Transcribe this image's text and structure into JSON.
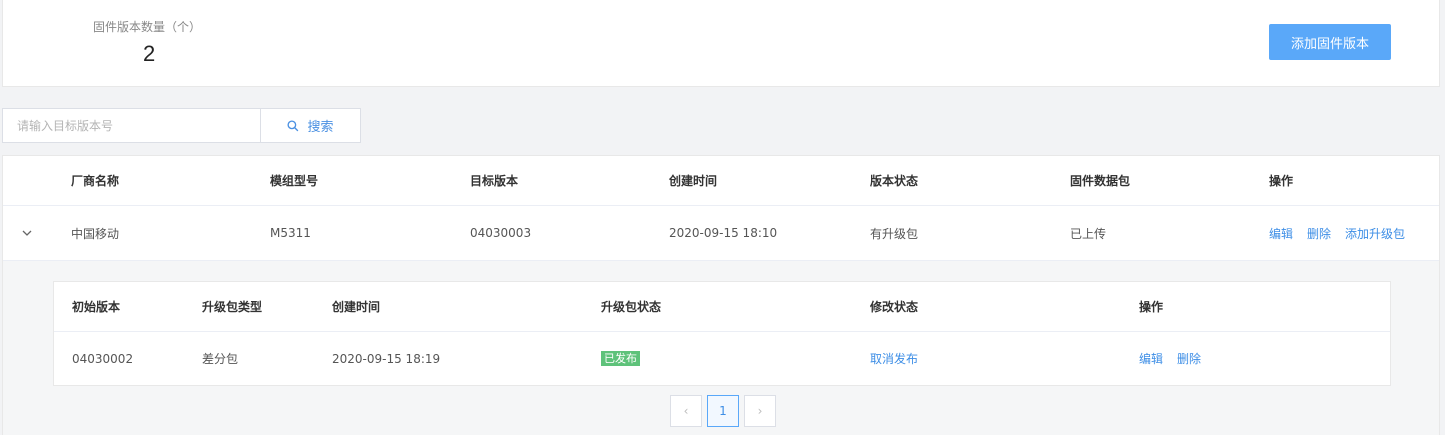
{
  "summary": {
    "label": "固件版本数量（个）",
    "value": "2",
    "add_button": "添加固件版本"
  },
  "search": {
    "placeholder": "请输入目标版本号",
    "value": "",
    "button": "搜索"
  },
  "table": {
    "headers": [
      "厂商名称",
      "模组型号",
      "目标版本",
      "创建时间",
      "版本状态",
      "固件数据包",
      "操作"
    ],
    "rows": [
      {
        "vendor": "中国移动",
        "model": "M5311",
        "target_version": "04030003",
        "created": "2020-09-15 18:10",
        "version_status": "有升级包",
        "package": "已上传",
        "actions": [
          "编辑",
          "删除",
          "添加升级包"
        ]
      }
    ]
  },
  "sub_table": {
    "headers": [
      "初始版本",
      "升级包类型",
      "创建时间",
      "升级包状态",
      "修改状态",
      "操作"
    ],
    "rows": [
      {
        "initial_version": "04030002",
        "package_type": "差分包",
        "created": "2020-09-15 18:19",
        "status": "已发布",
        "change_status": "取消发布",
        "actions": [
          "编辑",
          "删除"
        ]
      }
    ]
  },
  "pagination": {
    "prev": "‹",
    "current": "1",
    "next": "›"
  },
  "colors": {
    "accent": "#5aa8f9",
    "link": "#3d8ee6",
    "published_badge": "#5ec27a"
  }
}
